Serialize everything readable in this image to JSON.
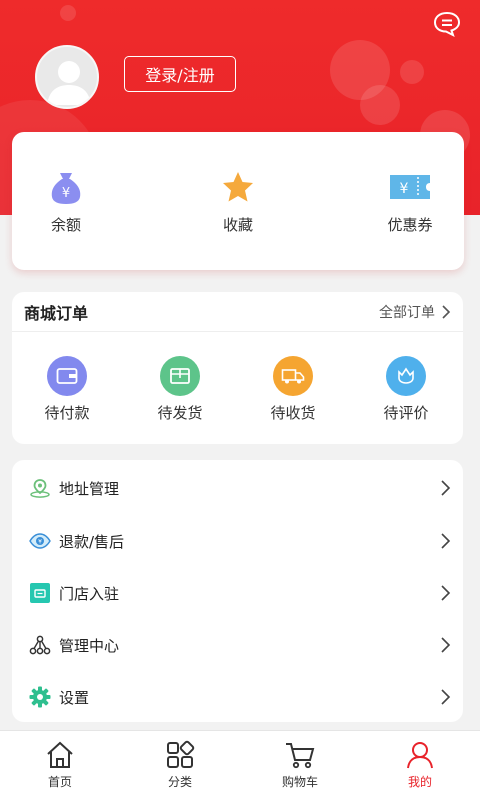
{
  "header": {
    "login_label": "登录/注册"
  },
  "wallet": {
    "items": [
      {
        "label": "余额",
        "icon": "money-bag-icon",
        "glyph": "¥"
      },
      {
        "label": "收藏",
        "icon": "star-icon"
      },
      {
        "label": "优惠券",
        "icon": "coupon-icon",
        "glyph": "¥"
      }
    ]
  },
  "orders": {
    "title": "商城订单",
    "all_label": "全部订单",
    "items": [
      {
        "label": "待付款",
        "icon": "wallet-icon",
        "color": "#7d83f0"
      },
      {
        "label": "待发货",
        "icon": "package-icon",
        "color": "#5dc48a"
      },
      {
        "label": "待收货",
        "icon": "truck-icon",
        "color": "#f5a531"
      },
      {
        "label": "待评价",
        "icon": "flower-icon",
        "color": "#4fb0ec"
      }
    ]
  },
  "menu": {
    "items": [
      {
        "label": "地址管理",
        "icon": "location-icon",
        "color": "#6cc07a"
      },
      {
        "label": "退款/售后",
        "icon": "refund-eye-icon",
        "color": "#3a8fd8"
      },
      {
        "label": "门店入驻",
        "icon": "store-icon",
        "color": "#26c7b0"
      },
      {
        "label": "管理中心",
        "icon": "network-icon",
        "color": "#333333"
      },
      {
        "label": "设置",
        "icon": "gear-icon",
        "color": "#2fbf8f"
      }
    ]
  },
  "tabbar": {
    "items": [
      {
        "label": "首页",
        "icon": "home-icon"
      },
      {
        "label": "分类",
        "icon": "grid-icon"
      },
      {
        "label": "购物车",
        "icon": "cart-icon"
      },
      {
        "label": "我的",
        "icon": "user-icon",
        "active": true
      }
    ]
  },
  "colors": {
    "brand_red": "#e8232a",
    "tab_active": "#e8232a"
  }
}
